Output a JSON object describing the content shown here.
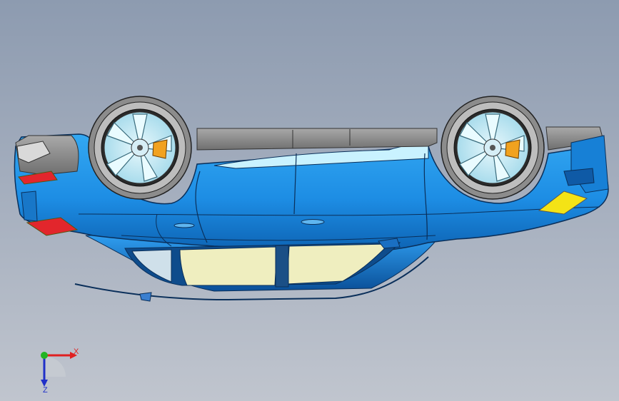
{
  "viewport": {
    "background_top": "#8d9bb0",
    "background_bottom": "#c0c5ce"
  },
  "model": {
    "body_color": "#1e8fe6",
    "body_dark": "#0b5fae",
    "window_color": "#efeebf",
    "trim_color": "#8a8a8a",
    "taillight_color": "#e2262c",
    "reflector_color": "#f4e316",
    "caliper_color": "#f1a21f",
    "rim_color": "#bfe8f4"
  },
  "triad": {
    "x_label": "X",
    "z_label": "Z",
    "x_color": "#e02020",
    "y_color": "#22b422",
    "z_color": "#2030c8"
  }
}
